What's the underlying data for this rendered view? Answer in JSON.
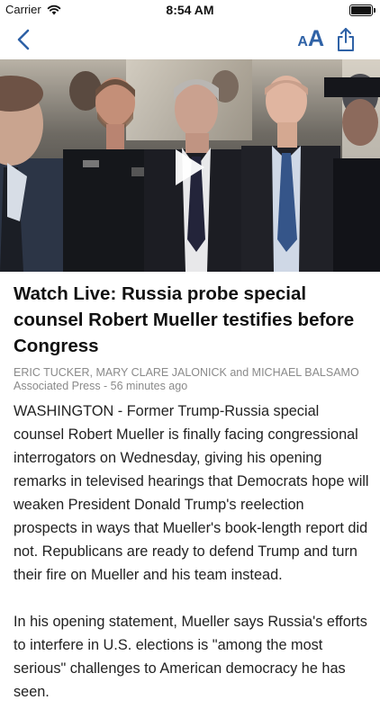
{
  "status_bar": {
    "carrier": "Carrier",
    "time": "8:54 AM",
    "icons": [
      "wifi-icon",
      "battery-icon"
    ]
  },
  "nav": {
    "back_icon": "chevron-left-icon",
    "font_size_small": "A",
    "font_size_large": "A",
    "share_icon": "share-icon",
    "accent_color": "#2f62a6"
  },
  "video": {
    "play_icon": "play-icon"
  },
  "article": {
    "headline": "Watch Live: Russia probe special counsel Robert Mueller testifies before Congress",
    "authors": "ERIC TUCKER, MARY CLARE JALONICK and MICHAEL BALSAMO",
    "source_line": "Associated Press - 56 minutes ago",
    "paragraphs": [
      "WASHINGTON - Former Trump-Russia special counsel Robert Mueller is finally facing congressional interrogators on Wednesday, giving his opening remarks in televised hearings that Democrats hope will weaken President Donald Trump's reelection prospects in ways that Mueller's book-length report did not. Republicans are ready to defend Trump and turn their fire on Mueller and his team instead.",
      "In his opening statement, Mueller says Russia's efforts to interfere in U.S. elections is \"among the most serious\" challenges to American democracy he has seen."
    ]
  }
}
